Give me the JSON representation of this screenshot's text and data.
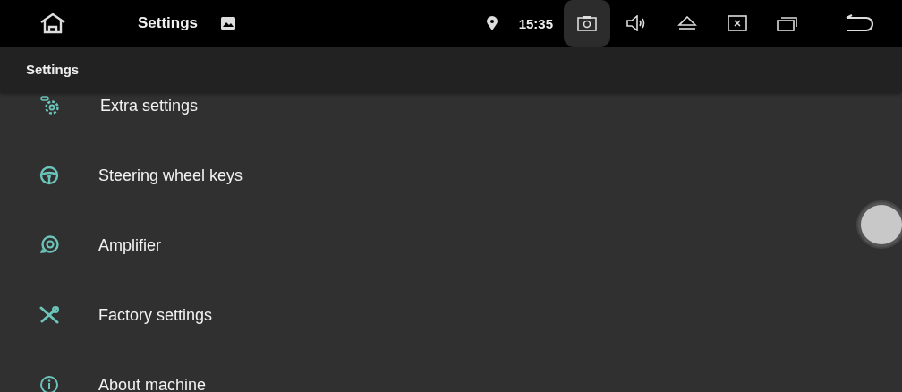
{
  "status_bar": {
    "title": "Settings",
    "time": "15:35",
    "buttons": [
      {
        "kind": "camera",
        "selected": true
      },
      {
        "kind": "volume",
        "selected": false
      },
      {
        "kind": "eject",
        "selected": false
      },
      {
        "kind": "close",
        "selected": false
      },
      {
        "kind": "windows",
        "selected": false
      }
    ]
  },
  "header": {
    "title": "Settings"
  },
  "items": [
    {
      "kind": "gear",
      "label": "Extra settings"
    },
    {
      "kind": "wheel",
      "label": "Steering wheel keys"
    },
    {
      "kind": "speaker",
      "label": "Amplifier"
    },
    {
      "kind": "tools",
      "label": "Factory settings"
    },
    {
      "kind": "info",
      "label": "About machine"
    }
  ]
}
